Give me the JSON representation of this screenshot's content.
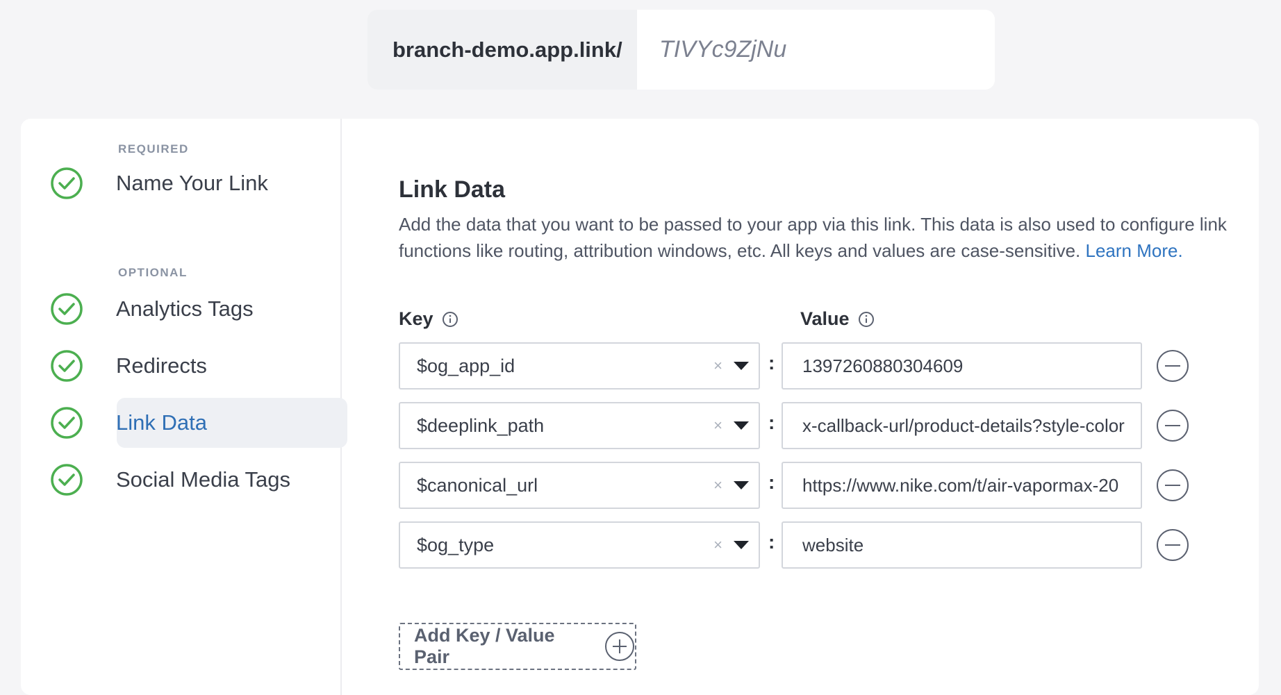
{
  "link": {
    "domain": "branch-demo.app.link/",
    "alias": "TIVYc9ZjNu"
  },
  "sidebar": {
    "required_label": "REQUIRED",
    "optional_label": "OPTIONAL",
    "steps": [
      {
        "label": "Name Your Link",
        "complete": true
      },
      {
        "label": "Analytics Tags",
        "complete": true
      },
      {
        "label": "Redirects",
        "complete": true
      },
      {
        "label": "Link Data",
        "complete": true,
        "active": true
      },
      {
        "label": "Social Media Tags",
        "complete": true
      }
    ]
  },
  "main": {
    "title": "Link Data",
    "description": "Add the data that you want to be passed to your app via this link. This data is also used to configure link functions like routing, attribution windows, etc. All keys and values are case-sensitive.",
    "learn_more": "Learn More.",
    "key_header": "Key",
    "value_header": "Value",
    "pairs": [
      {
        "key": "$og_app_id",
        "value": "1397260880304609"
      },
      {
        "key": "$deeplink_path",
        "value": "x-callback-url/product-details?style-color"
      },
      {
        "key": "$canonical_url",
        "value": "https://www.nike.com/t/air-vapormax-20"
      },
      {
        "key": "$og_type",
        "value": "website"
      }
    ],
    "clear_glyph": "×",
    "colon": ":",
    "add_button": "Add Key / Value Pair"
  },
  "colors": {
    "check": "#4caf50",
    "active_text": "#2f6fb5",
    "link": "#2f74c0"
  }
}
